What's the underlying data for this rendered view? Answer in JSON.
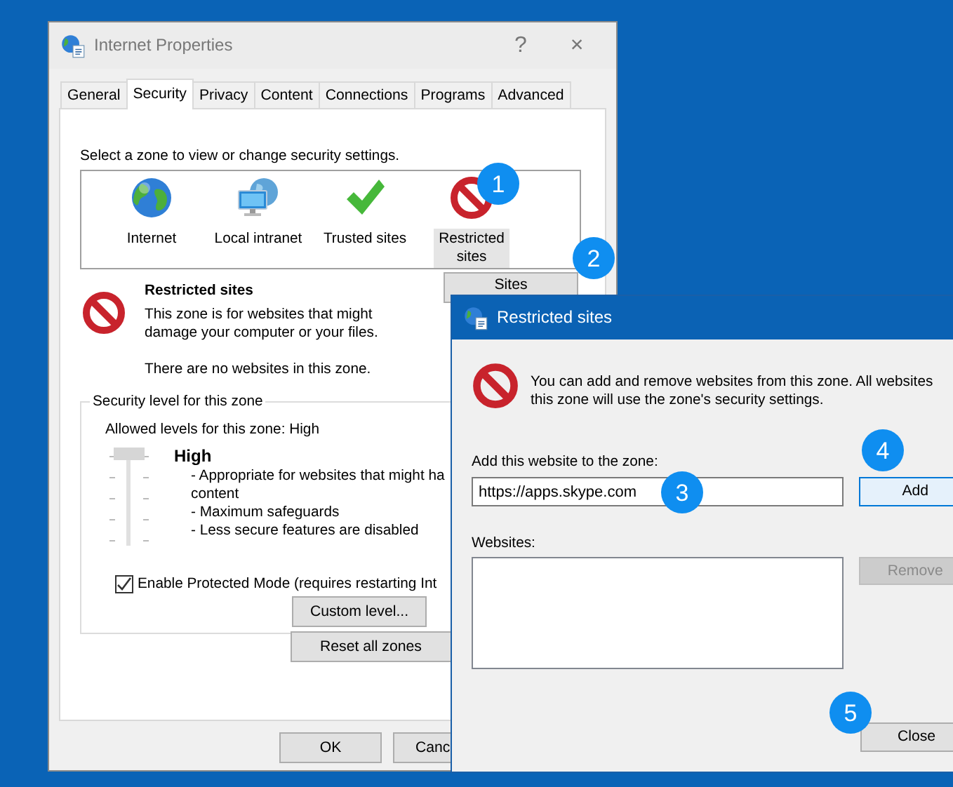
{
  "main_window": {
    "title": "Internet Properties",
    "help_button": "?",
    "close_button": "×",
    "tabs": [
      {
        "label": "General",
        "selected": false
      },
      {
        "label": "Security",
        "selected": true
      },
      {
        "label": "Privacy",
        "selected": false
      },
      {
        "label": "Content",
        "selected": false
      },
      {
        "label": "Connections",
        "selected": false
      },
      {
        "label": "Programs",
        "selected": false
      },
      {
        "label": "Advanced",
        "selected": false
      }
    ],
    "zone_prompt": "Select a zone to view or change security settings.",
    "zones": [
      {
        "label": "Internet",
        "kind": "internet",
        "selected": false
      },
      {
        "label": "Local intranet",
        "kind": "intranet",
        "selected": false
      },
      {
        "label": "Trusted sites",
        "kind": "trusted",
        "selected": false
      },
      {
        "label": "Restricted sites",
        "kind": "restricted",
        "selected": true
      }
    ],
    "zone_info": {
      "title": "Restricted sites",
      "description": "This zone is for websites that might damage your computer or your files.",
      "note": "There are no websites in this zone.",
      "sites_button": "Sites"
    },
    "security_level": {
      "legend": "Security level for this zone",
      "allowed": "Allowed levels for this zone: High",
      "level": 1,
      "level_name": "High",
      "details": [
        "- Appropriate for websites that might ha",
        "content",
        "- Maximum safeguards",
        "- Less secure features are disabled"
      ]
    },
    "protected_mode": {
      "label": "Enable Protected Mode (requires restarting Int",
      "checked": true
    },
    "custom_level_button": "Custom level...",
    "reset_button": "Reset all zones",
    "ok_button": "OK",
    "cancel_button": "Canc"
  },
  "dialog": {
    "title": "Restricted sites",
    "message_lines": [
      "You can add and remove websites from this zone. All websites",
      "this zone will use the zone's security settings."
    ],
    "add_label": "Add this website to the zone:",
    "add_value": "https://apps.skype.com",
    "add_button": "Add",
    "websites_label": "Websites:",
    "remove_button": {
      "label": "Remove",
      "disabled": true
    },
    "close_button": "Close"
  },
  "callouts": [
    "1",
    "2",
    "3",
    "4",
    "5"
  ]
}
